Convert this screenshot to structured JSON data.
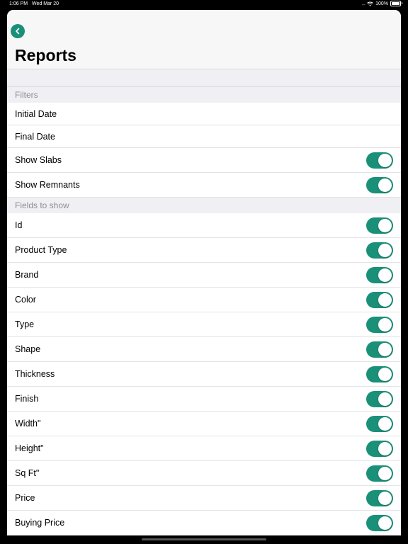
{
  "status": {
    "time": "1:06 PM",
    "date": "Wed Mar 20",
    "battery": "100%",
    "signal": "....."
  },
  "colors": {
    "accent": "#1a9079",
    "groupedBackground": "#efeff4",
    "sectionText": "#8e8e93"
  },
  "icons": {
    "back": "chevron-left-icon",
    "wifi": "wifi-icon",
    "battery": "battery-icon"
  },
  "header": {
    "title": "Reports"
  },
  "sections": {
    "filters": {
      "title": "Filters",
      "rows": [
        {
          "label": "Initial Date",
          "has_toggle": false
        },
        {
          "label": "Final Date",
          "has_toggle": false
        },
        {
          "label": "Show Slabs",
          "has_toggle": true,
          "on": true
        },
        {
          "label": "Show Remnants",
          "has_toggle": true,
          "on": true
        }
      ]
    },
    "fields": {
      "title": "Fields to show",
      "rows": [
        {
          "label": "Id",
          "on": true
        },
        {
          "label": "Product Type",
          "on": true
        },
        {
          "label": "Brand",
          "on": true
        },
        {
          "label": "Color",
          "on": true
        },
        {
          "label": "Type",
          "on": true
        },
        {
          "label": "Shape",
          "on": true
        },
        {
          "label": "Thickness",
          "on": true
        },
        {
          "label": "Finish",
          "on": true
        },
        {
          "label": "Width\"",
          "on": true
        },
        {
          "label": "Height\"",
          "on": true
        },
        {
          "label": "Sq Ft\"",
          "on": true
        },
        {
          "label": "Price",
          "on": true
        },
        {
          "label": "Buying Price",
          "on": true
        }
      ]
    }
  }
}
